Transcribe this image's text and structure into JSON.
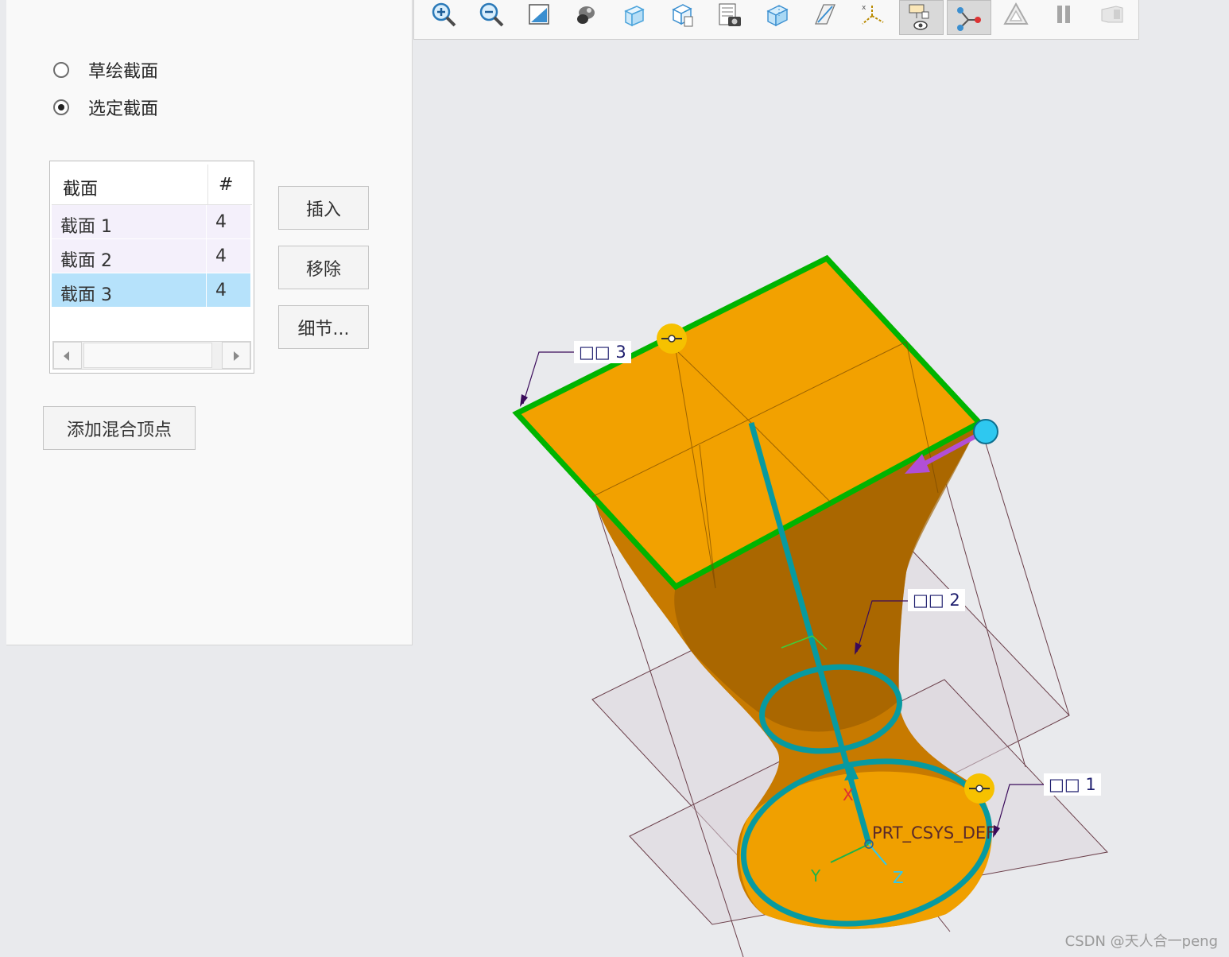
{
  "left_panel": {
    "radio_options": [
      {
        "label": "草绘截面",
        "selected": false
      },
      {
        "label": "选定截面",
        "selected": true
      }
    ],
    "section_table": {
      "headers": [
        "截面",
        "#"
      ],
      "rows": [
        {
          "name": "截面 1",
          "count": "4",
          "selected": false
        },
        {
          "name": "截面 2",
          "count": "4",
          "selected": false
        },
        {
          "name": "截面 3",
          "count": "4",
          "selected": true
        }
      ]
    },
    "buttons": {
      "insert": "插入",
      "remove": "移除",
      "details": "细节..."
    },
    "add_blend_vertex": "添加混合顶点"
  },
  "toolbar": {
    "icons": [
      "zoom-in-icon",
      "zoom-out-icon",
      "refit-icon",
      "shading-icon",
      "box-display-icon",
      "hidden-line-icon",
      "saved-views-icon",
      "wireframe-box-icon",
      "plane-display-icon",
      "csys-display-icon",
      "view-manager-icon",
      "datum-display-icon",
      "blend-preview-icon",
      "pause-icon",
      "feature-preview-icon"
    ],
    "pressed": [
      "view-manager-icon",
      "datum-display-icon"
    ]
  },
  "viewport": {
    "callouts": [
      "□□ 3",
      "□□ 2",
      "□□ 1"
    ],
    "csys_label": "PRT_CSYS_DEF",
    "axis_labels": {
      "x": "X",
      "y": "Y",
      "z": "Z"
    },
    "colors": {
      "solid": "#f2a100",
      "section_outline": "#00b400",
      "trajectory": "#079aa0",
      "drag_handle": "#f6c100",
      "start_point": "#2ec8f0",
      "direction_arrow": "#b14fd6"
    }
  },
  "watermark": "CSDN @天人合一peng"
}
